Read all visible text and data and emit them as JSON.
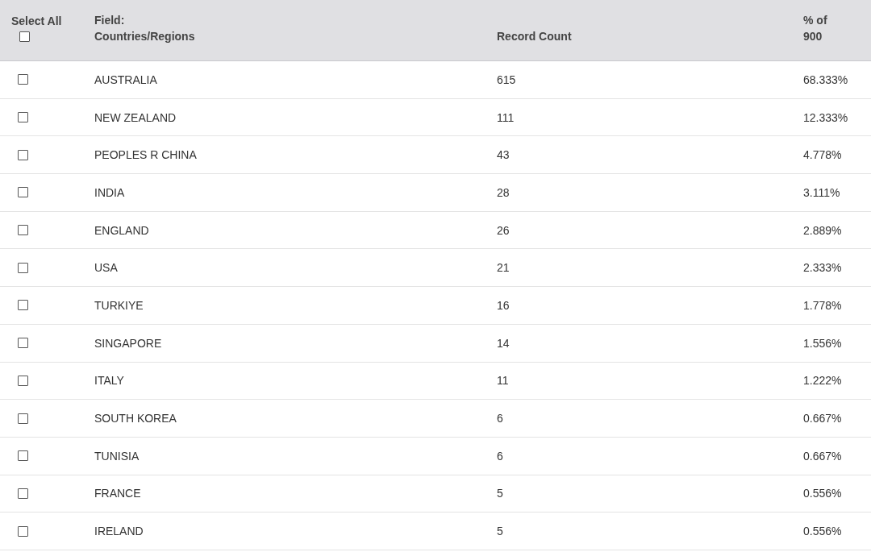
{
  "table": {
    "select_all": {
      "label": "Select All",
      "checked": false
    },
    "columns": [
      "Field:\nCountries/Regions",
      "Record Count",
      "% of 900"
    ],
    "rows": [
      {
        "checked": false,
        "name": "AUSTRALIA",
        "count": "615",
        "percent": "68.333%"
      },
      {
        "checked": false,
        "name": "NEW ZEALAND",
        "count": "111",
        "percent": "12.333%"
      },
      {
        "checked": false,
        "name": "PEOPLES R CHINA",
        "count": "43",
        "percent": "4.778%"
      },
      {
        "checked": false,
        "name": "INDIA",
        "count": "28",
        "percent": "3.111%"
      },
      {
        "checked": false,
        "name": "ENGLAND",
        "count": "26",
        "percent": "2.889%"
      },
      {
        "checked": false,
        "name": "USA",
        "count": "21",
        "percent": "2.333%"
      },
      {
        "checked": false,
        "name": "TURKIYE",
        "count": "16",
        "percent": "1.778%"
      },
      {
        "checked": false,
        "name": "SINGAPORE",
        "count": "14",
        "percent": "1.556%"
      },
      {
        "checked": false,
        "name": "ITALY",
        "count": "11",
        "percent": "1.222%"
      },
      {
        "checked": false,
        "name": "SOUTH KOREA",
        "count": "6",
        "percent": "0.667%"
      },
      {
        "checked": false,
        "name": "TUNISIA",
        "count": "6",
        "percent": "0.667%"
      },
      {
        "checked": false,
        "name": "FRANCE",
        "count": "5",
        "percent": "0.556%"
      },
      {
        "checked": false,
        "name": "IRELAND",
        "count": "5",
        "percent": "0.556%"
      }
    ]
  }
}
